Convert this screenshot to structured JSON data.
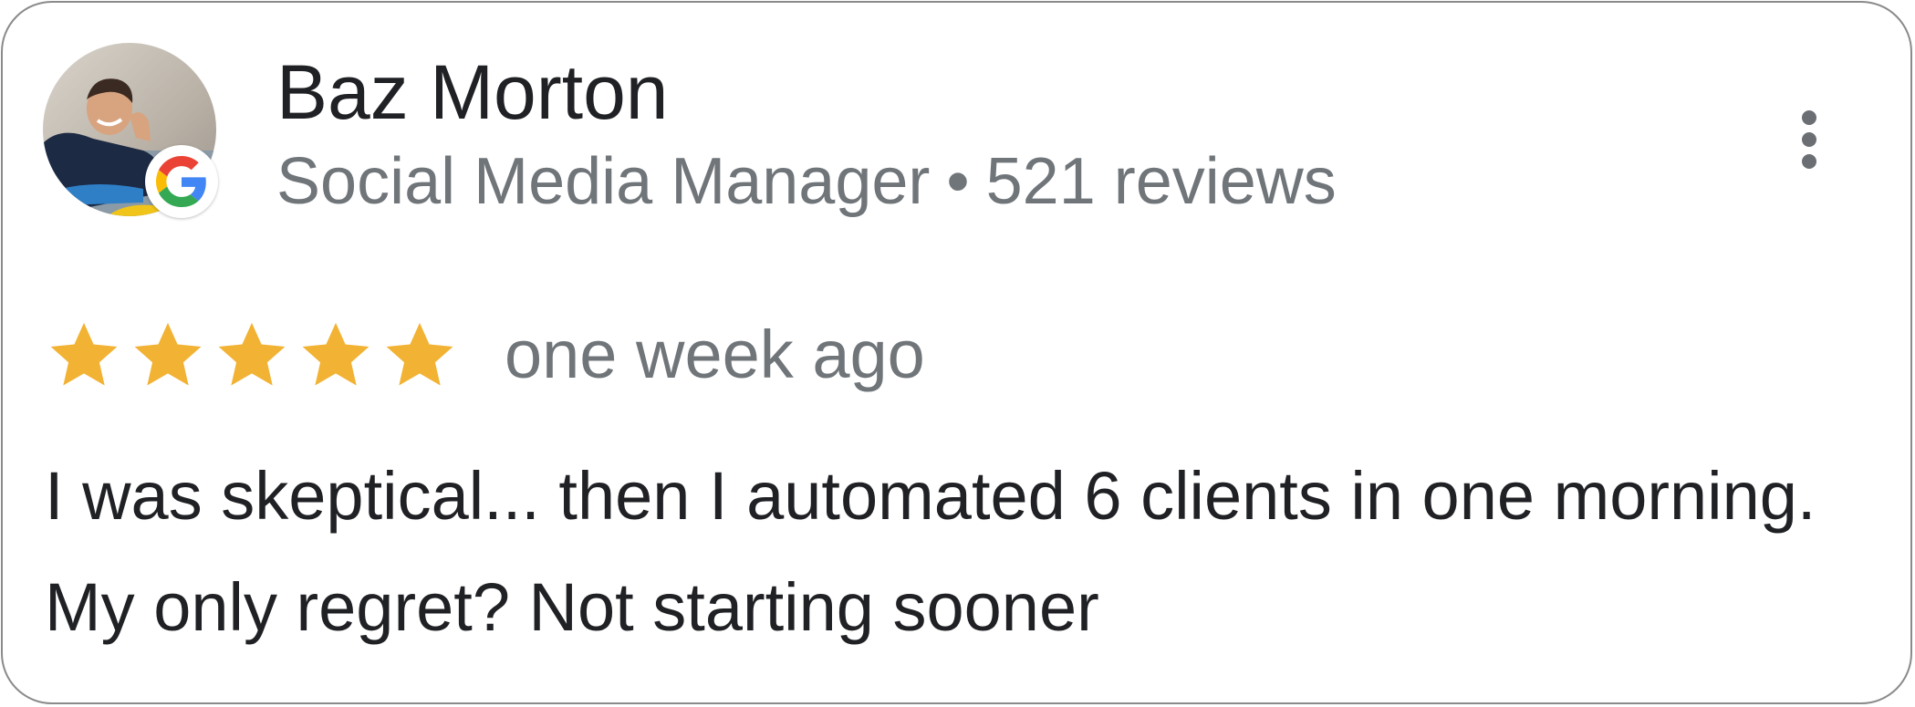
{
  "reviewer": {
    "name": "Baz Morton",
    "role": "Social Media Manager",
    "separator": "•",
    "review_count": "521 reviews"
  },
  "review": {
    "rating": 5,
    "max_rating": 5,
    "time_ago": "one week ago",
    "text": "I was skeptical... then I automated 6 clients in one morning. My only regret? Not starting sooner"
  },
  "icons": {
    "avatar": "avatar-photo",
    "badge": "google-icon",
    "menu": "more-vert-icon",
    "star": "star-icon"
  },
  "colors": {
    "star": "#F2B233",
    "name_text": "#202124",
    "secondary_text": "#70757A",
    "border": "#8A8A8A"
  }
}
